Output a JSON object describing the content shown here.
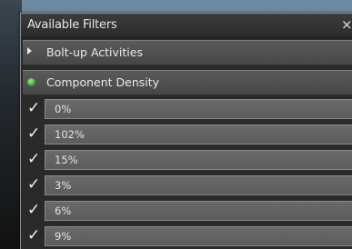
{
  "panel": {
    "title": "Available Filters",
    "close_symbol": "×"
  },
  "groups": [
    {
      "label": "Bolt-up Activities",
      "icon": "expand-arrow-icon",
      "expanded": false
    },
    {
      "label": "Component Density",
      "icon": "green-status-dot-icon",
      "status_color": "#3aa83a",
      "expanded": true
    }
  ],
  "items": [
    {
      "label": "0%",
      "checked": true
    },
    {
      "label": "102%",
      "checked": true
    },
    {
      "label": "15%",
      "checked": true
    },
    {
      "label": "3%",
      "checked": true
    },
    {
      "label": "6%",
      "checked": true
    },
    {
      "label": "9%",
      "checked": true
    }
  ],
  "check_symbol": "✓"
}
